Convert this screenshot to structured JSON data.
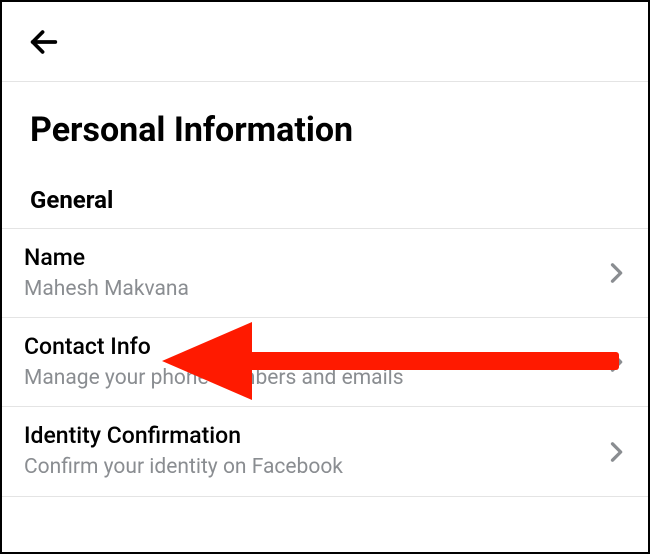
{
  "header": {
    "back_icon_name": "back-icon"
  },
  "page": {
    "title": "Personal Information"
  },
  "section": {
    "label": "General"
  },
  "items": [
    {
      "label": "Name",
      "sub": "Mahesh Makvana"
    },
    {
      "label": "Contact Info",
      "sub": "Manage your phone numbers and emails"
    },
    {
      "label": "Identity Confirmation",
      "sub": "Confirm your identity on Facebook"
    }
  ]
}
